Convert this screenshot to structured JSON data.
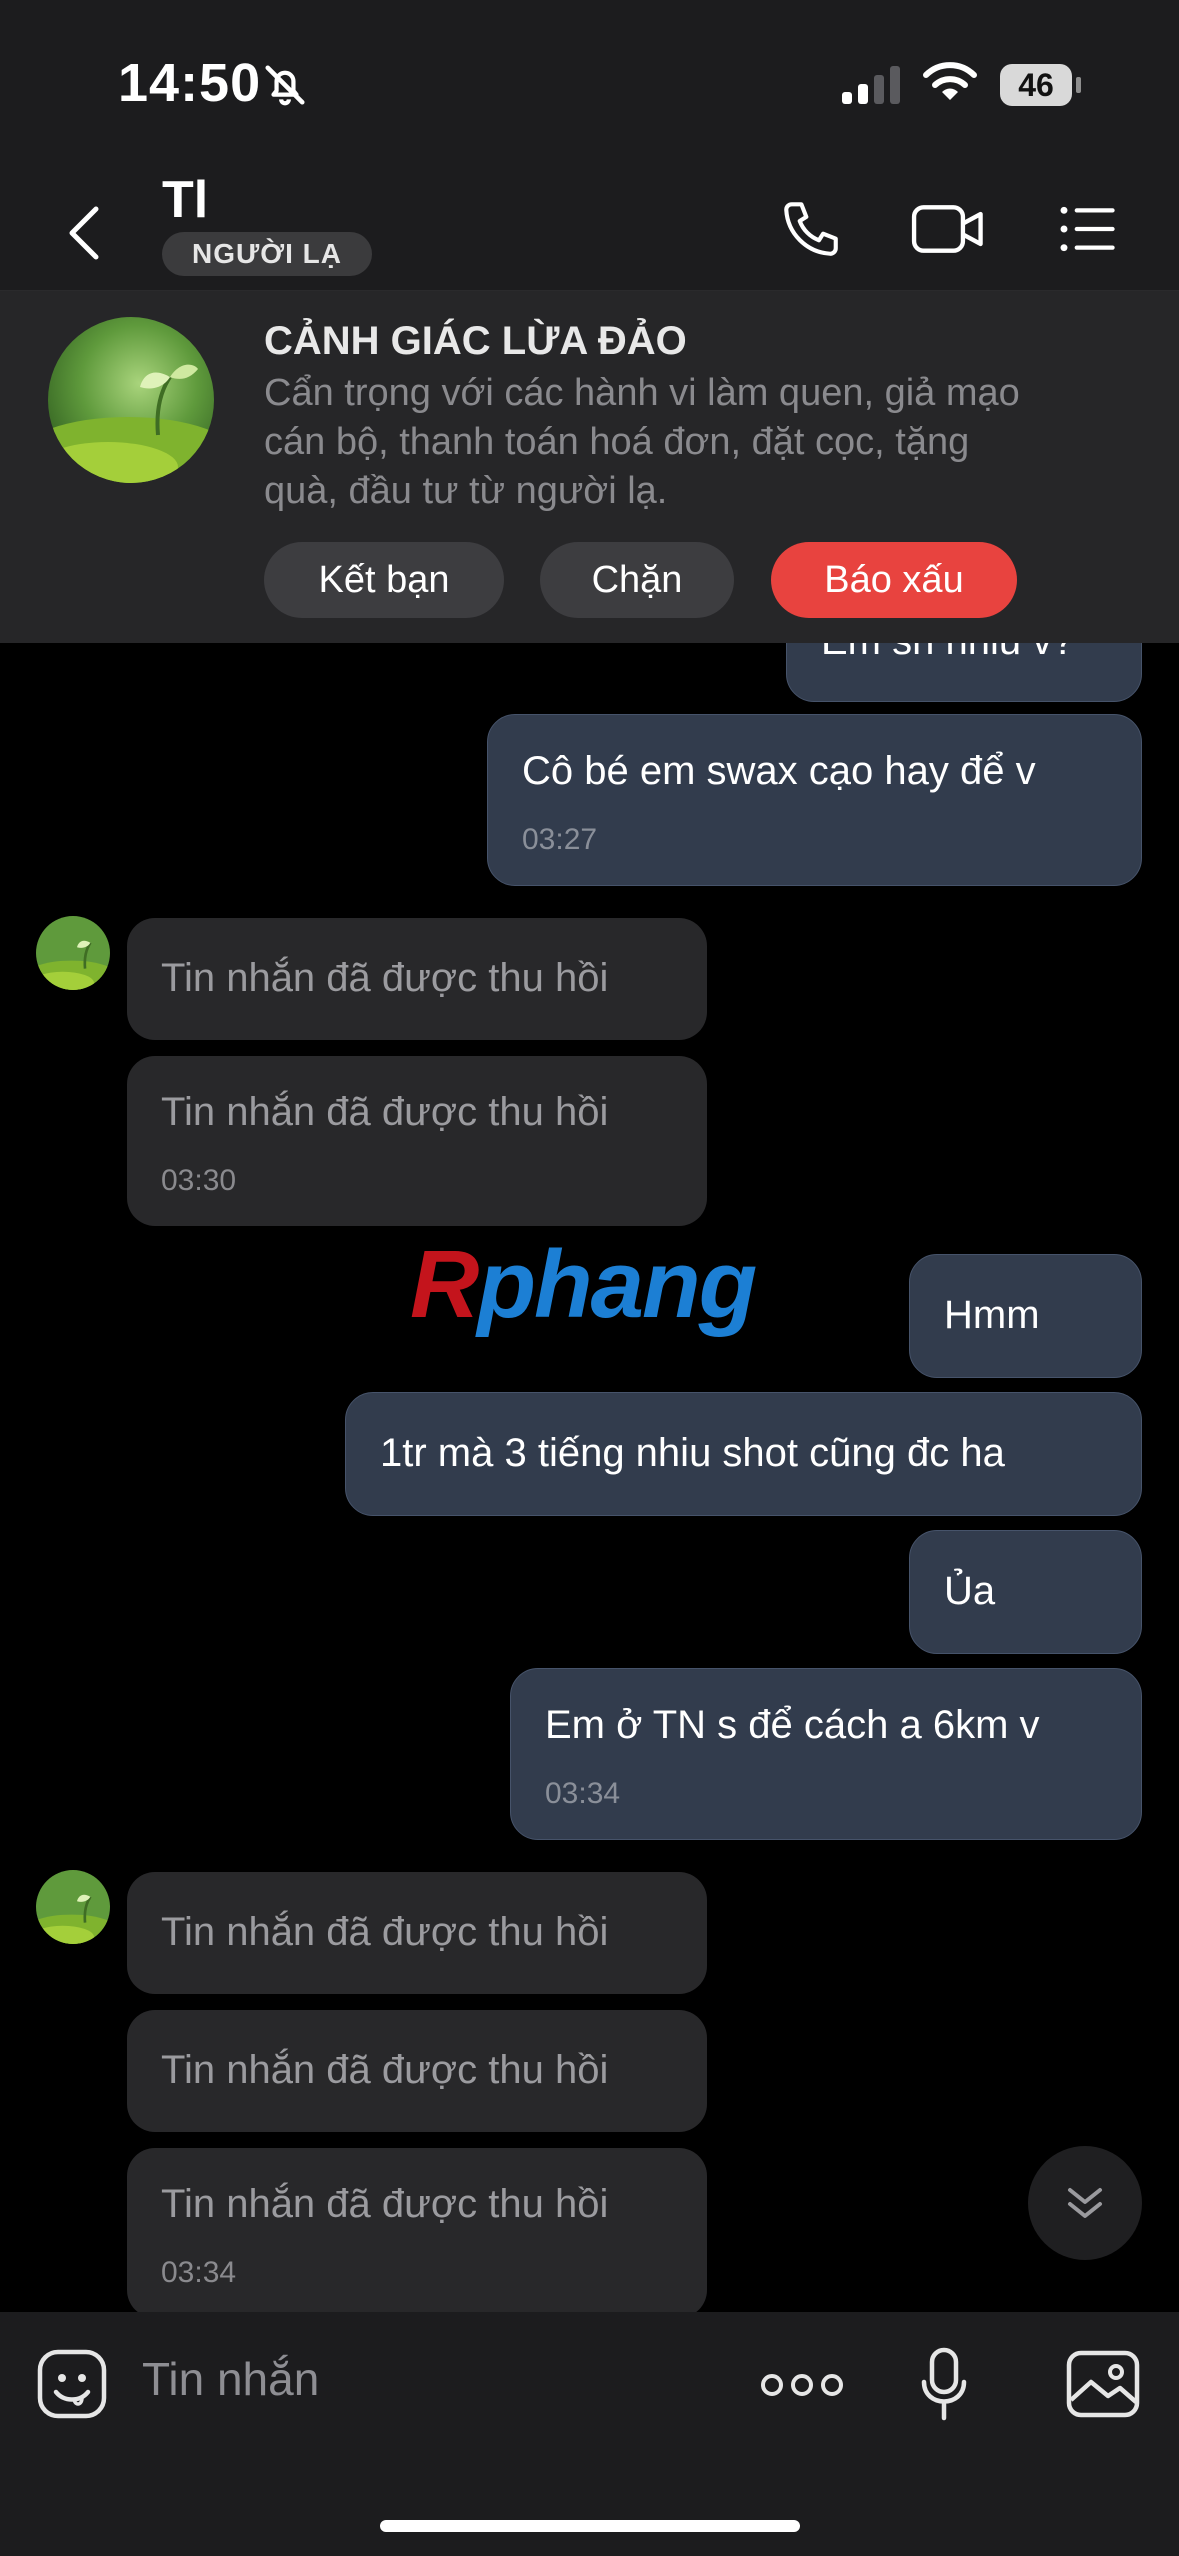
{
  "status_bar": {
    "time": "14:50",
    "battery": "46"
  },
  "header": {
    "title": "Tl",
    "badge": "NGƯỜI LẠ"
  },
  "warning": {
    "title": "CẢNH GIÁC LỪA ĐẢO",
    "line1": "Cẩn trọng với các hành vi làm quen, giả mạo",
    "line2": "cán bộ, thanh toán hoá đơn, đặt cọc, tặng",
    "line3": "quà, đầu tư từ người lạ.",
    "add_friend": "Kết bạn",
    "block": "Chặn",
    "report": "Báo xấu"
  },
  "messages": {
    "m0": {
      "text": "Em sn nhiu v?"
    },
    "m1": {
      "text": "Cô bé em swax cạo hay để v",
      "time": "03:27"
    },
    "m2": {
      "text": "Tin nhắn đã được thu hồi"
    },
    "m3": {
      "text": "Tin nhắn đã được thu hồi",
      "time": "03:30"
    },
    "m4": {
      "text": "Hmm"
    },
    "m5": {
      "text": "1tr mà 3 tiếng nhiu shot cũng đc ha"
    },
    "m6": {
      "text": "Ủa"
    },
    "m7": {
      "text": "Em ở TN s để cách a 6km v",
      "time": "03:34"
    },
    "m8": {
      "text": "Tin nhắn đã được thu hồi"
    },
    "m9": {
      "text": "Tin nhắn đã được thu hồi"
    },
    "m10": {
      "text": "Tin nhắn đã được thu hồi",
      "time": "03:34"
    }
  },
  "watermark": {
    "r": "R",
    "rest": "phang"
  },
  "input": {
    "placeholder": "Tin nhắn"
  },
  "colors": {
    "outgoing": "#323c4d",
    "incoming": "#28282a",
    "report": "#e8433f"
  }
}
